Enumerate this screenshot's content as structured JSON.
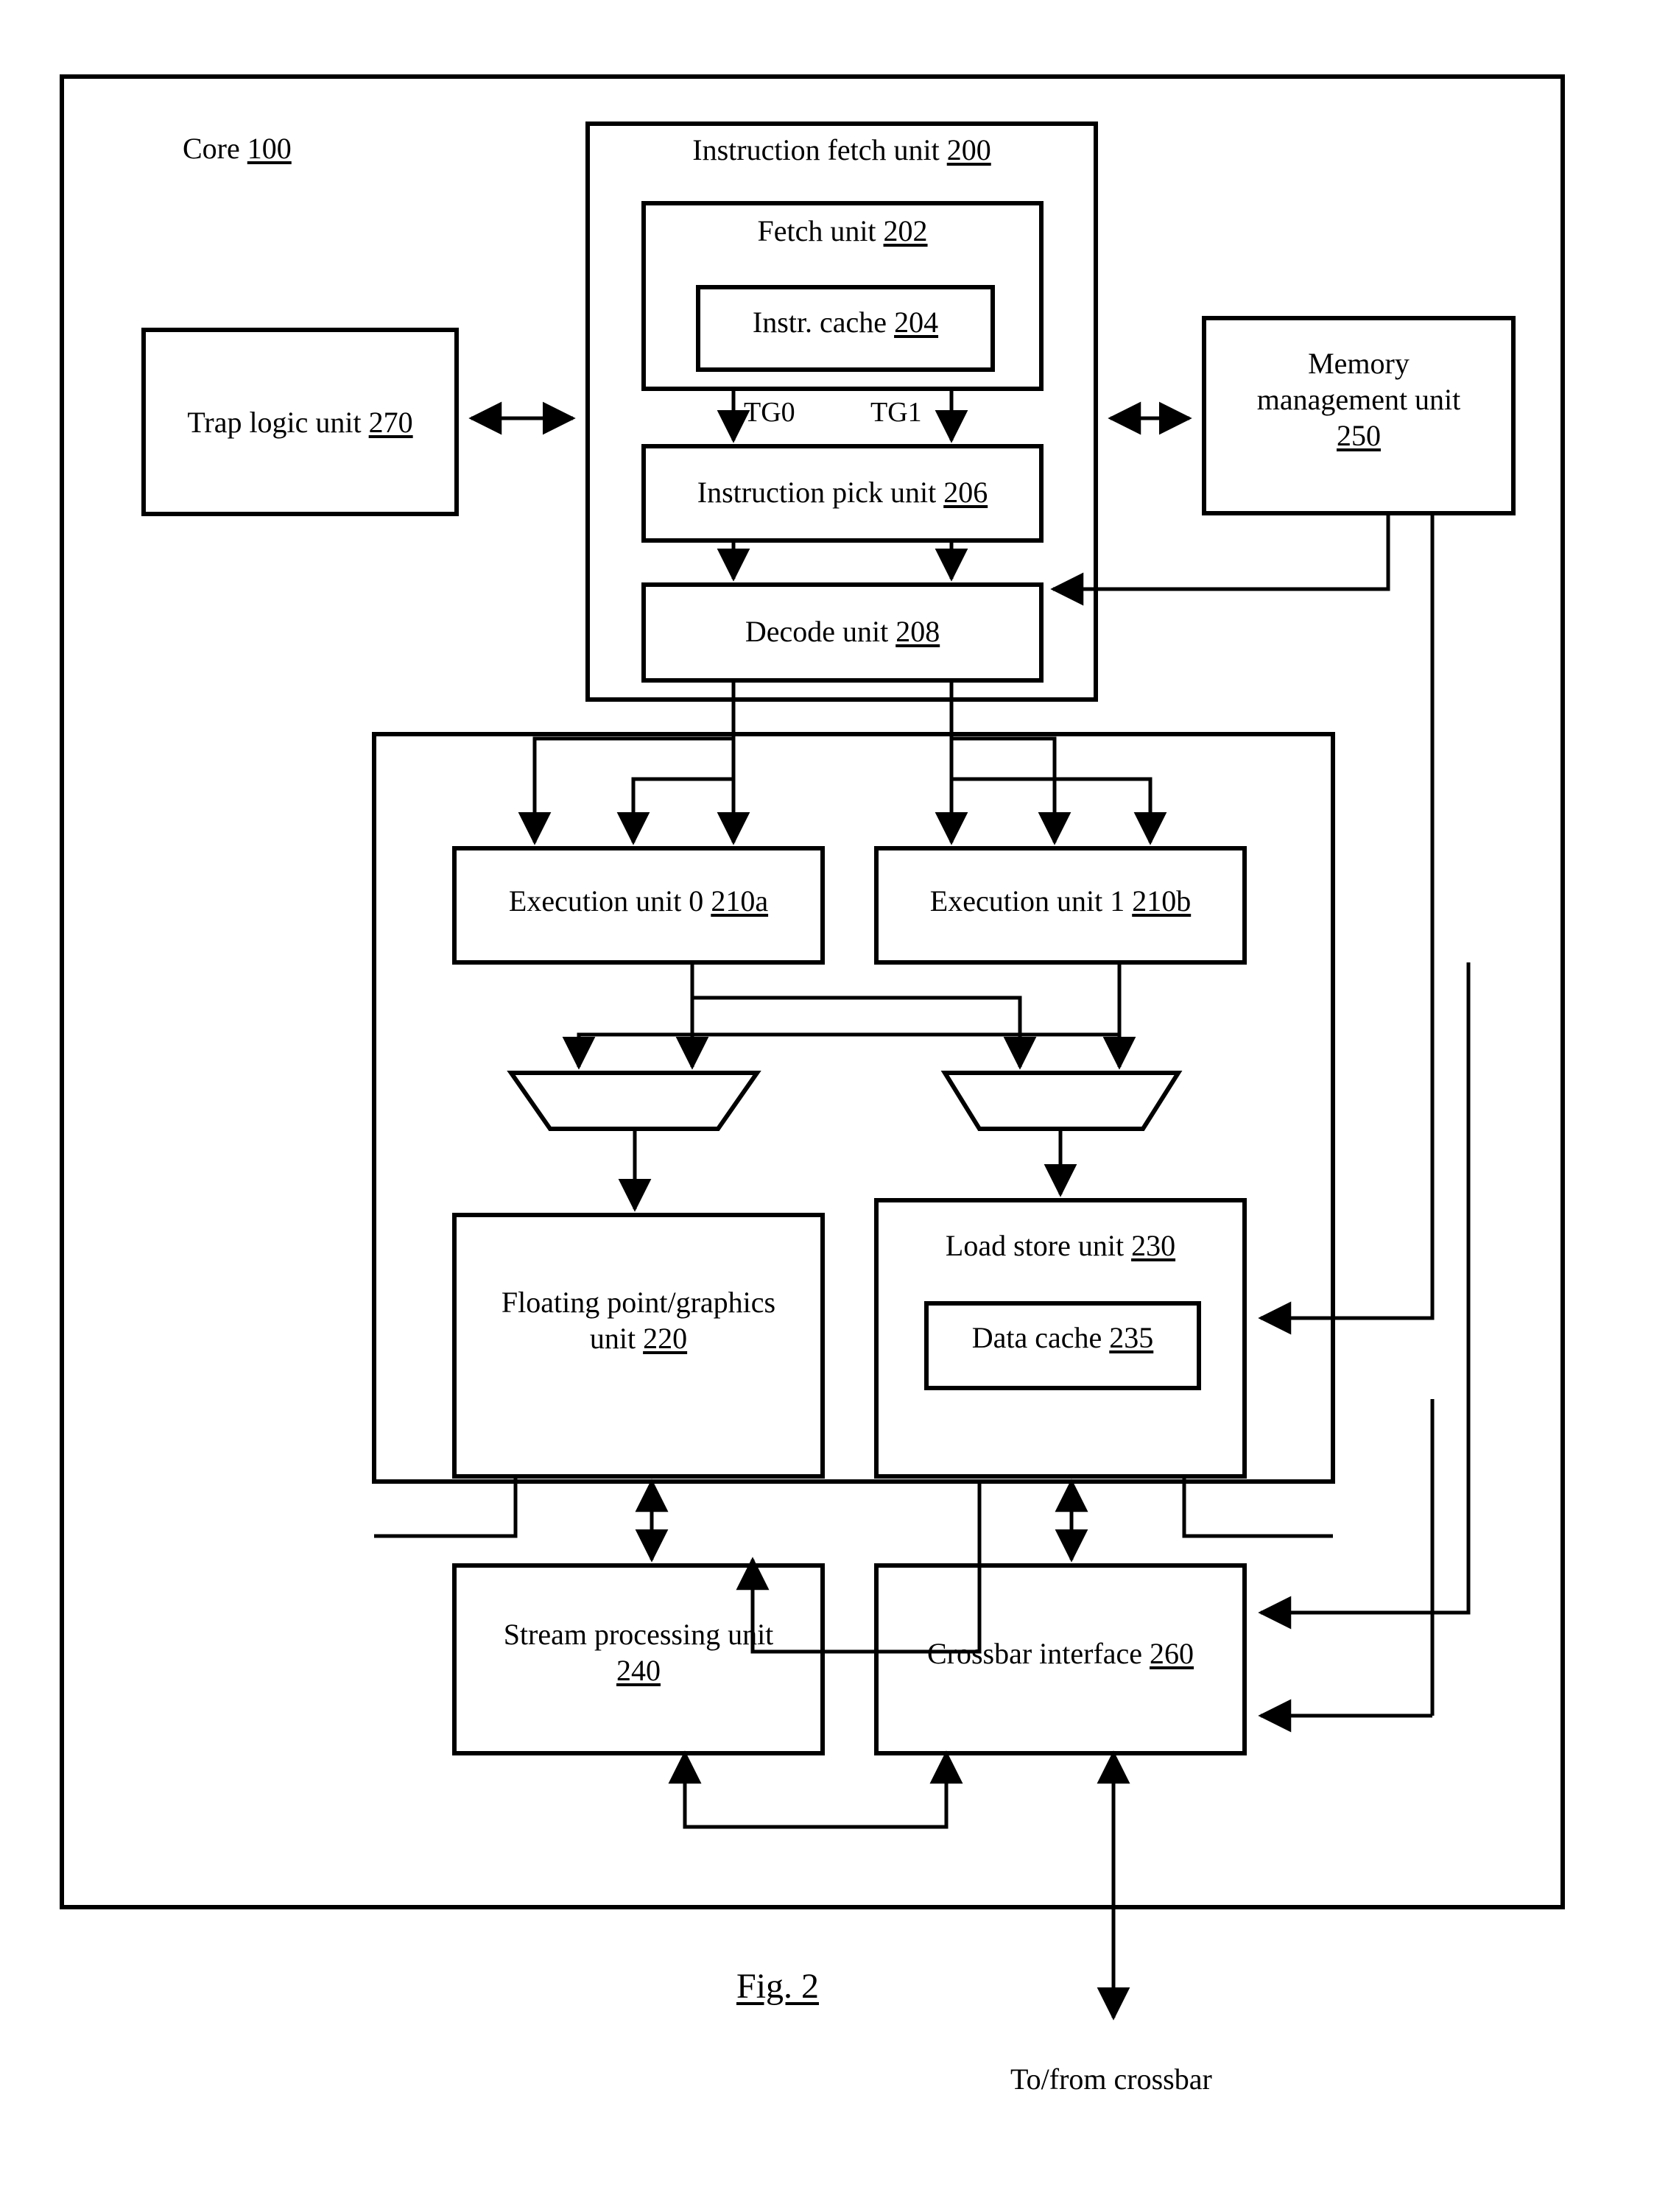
{
  "figure": {
    "caption": "Fig. 2",
    "core_label": "Core",
    "core_ref": "100",
    "external_label": "To/from crossbar"
  },
  "signals": {
    "tg0": "TG0",
    "tg1": "TG1"
  },
  "blocks": {
    "instruction_fetch_unit": {
      "label": "Instruction fetch unit",
      "ref": "200"
    },
    "fetch_unit": {
      "label": "Fetch unit",
      "ref": "202"
    },
    "instr_cache": {
      "label": "Instr. cache",
      "ref": "204"
    },
    "instruction_pick_unit": {
      "label": "Instruction pick unit",
      "ref": "206"
    },
    "decode_unit": {
      "label": "Decode unit",
      "ref": "208"
    },
    "trap_logic_unit": {
      "label": "Trap logic unit",
      "ref": "270"
    },
    "memory_management_unit": {
      "label_line1": "Memory",
      "label_line2": "management unit",
      "ref": "250"
    },
    "execution_unit_0": {
      "label": "Execution unit 0",
      "ref": "210a"
    },
    "execution_unit_1": {
      "label": "Execution unit 1",
      "ref": "210b"
    },
    "fpg_unit": {
      "label_line1": "Floating point/graphics",
      "label_line2": "unit",
      "ref": "220"
    },
    "load_store_unit": {
      "label": "Load store unit",
      "ref": "230"
    },
    "data_cache": {
      "label": "Data cache",
      "ref": "235"
    },
    "stream_processing_unit": {
      "label_line1": "Stream processing unit",
      "ref": "240"
    },
    "crossbar_interface": {
      "label": "Crossbar interface",
      "ref": "260"
    }
  },
  "colors": {
    "ink": "#000000",
    "paper": "#ffffff"
  }
}
